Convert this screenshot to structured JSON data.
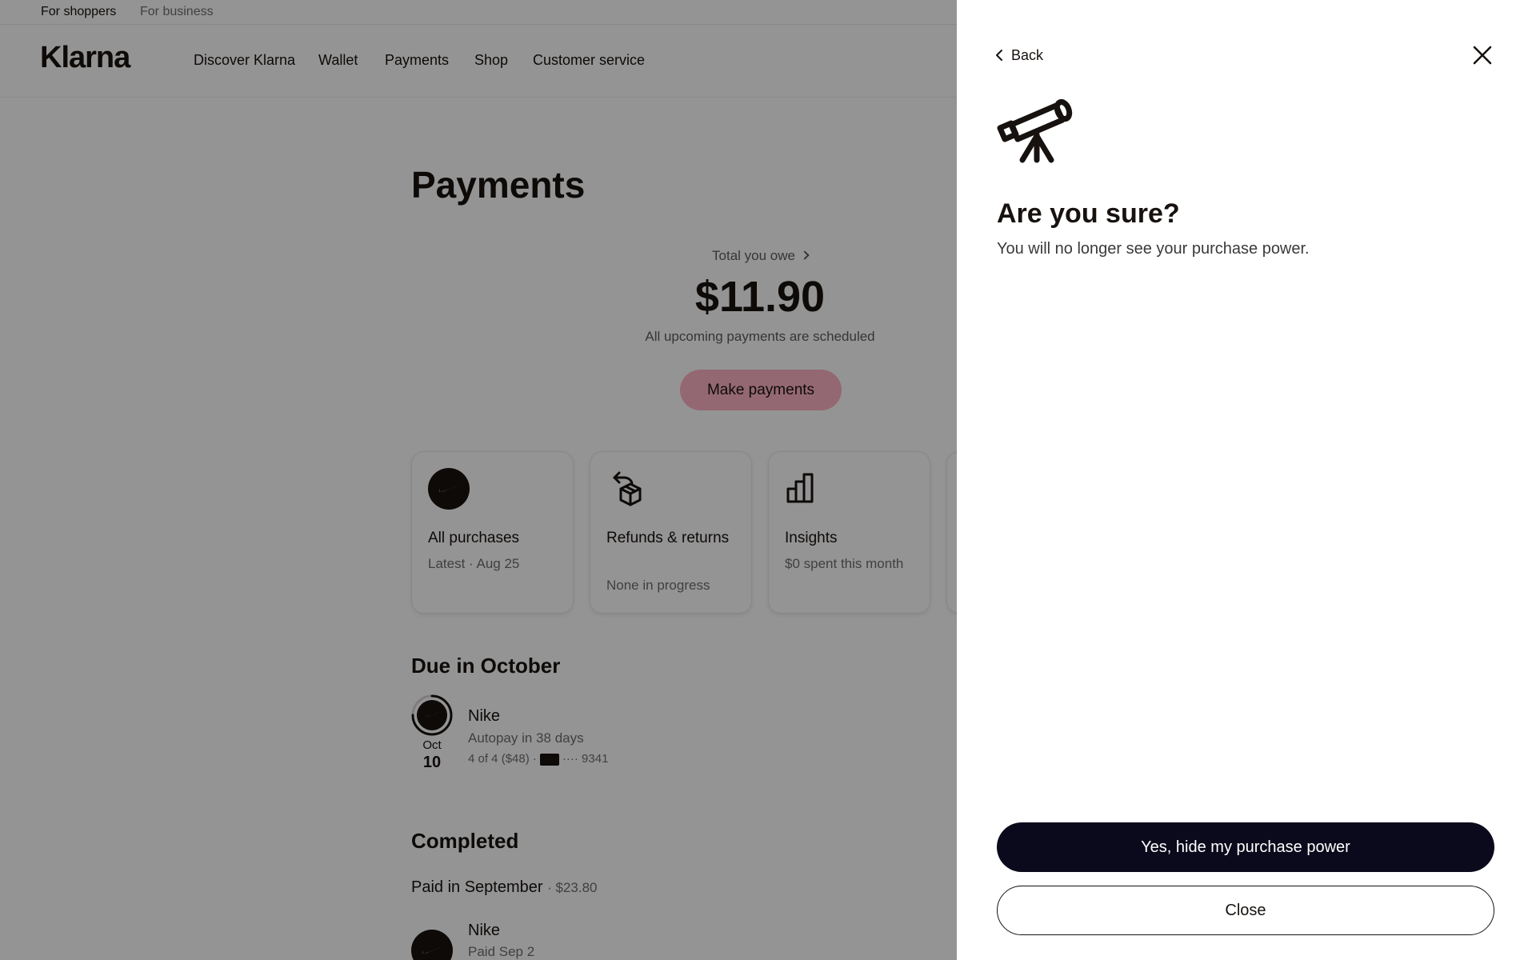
{
  "topbar": {
    "shoppers": "For shoppers",
    "business": "For business"
  },
  "nav": {
    "logo": "Klarna",
    "links": [
      "Discover Klarna",
      "Wallet",
      "Payments",
      "Shop",
      "Customer service"
    ]
  },
  "payments": {
    "title": "Payments",
    "total_label": "Total you owe",
    "total_amount": "$11.90",
    "total_sub": "All upcoming payments are scheduled",
    "make_payments": "Make payments"
  },
  "cards": [
    {
      "title": "All purchases",
      "sub": "Latest · Aug 25",
      "icon": "nike-logo-icon"
    },
    {
      "title": "Refunds & returns",
      "sub": "None in progress",
      "icon": "box-return-icon"
    },
    {
      "title": "Insights",
      "sub": "$0 spent this month",
      "icon": "bar-chart-icon"
    }
  ],
  "due": {
    "title": "Due in October",
    "month": "Oct",
    "day": "10",
    "merchant": "Nike",
    "autopay": "Autopay in 38 days",
    "installment": "4 of 4 ($48) ·",
    "card_digits": "···· 9341",
    "progress": 0.75
  },
  "completed": {
    "title": "Completed",
    "paid_label": "Paid in September",
    "paid_amount": "· $23.80",
    "merchant": "Nike",
    "sub": "Paid Sep 2"
  },
  "panel": {
    "back": "Back",
    "title": "Are you sure?",
    "description": "You will no longer see your purchase power.",
    "confirm": "Yes, hide my purchase power",
    "close": "Close",
    "icon": "telescope-icon"
  },
  "colors": {
    "accent_pink": "#ffb3c7",
    "primary_dark": "#0b0a1c",
    "overlay": "rgba(0,0,0,0.42)"
  }
}
